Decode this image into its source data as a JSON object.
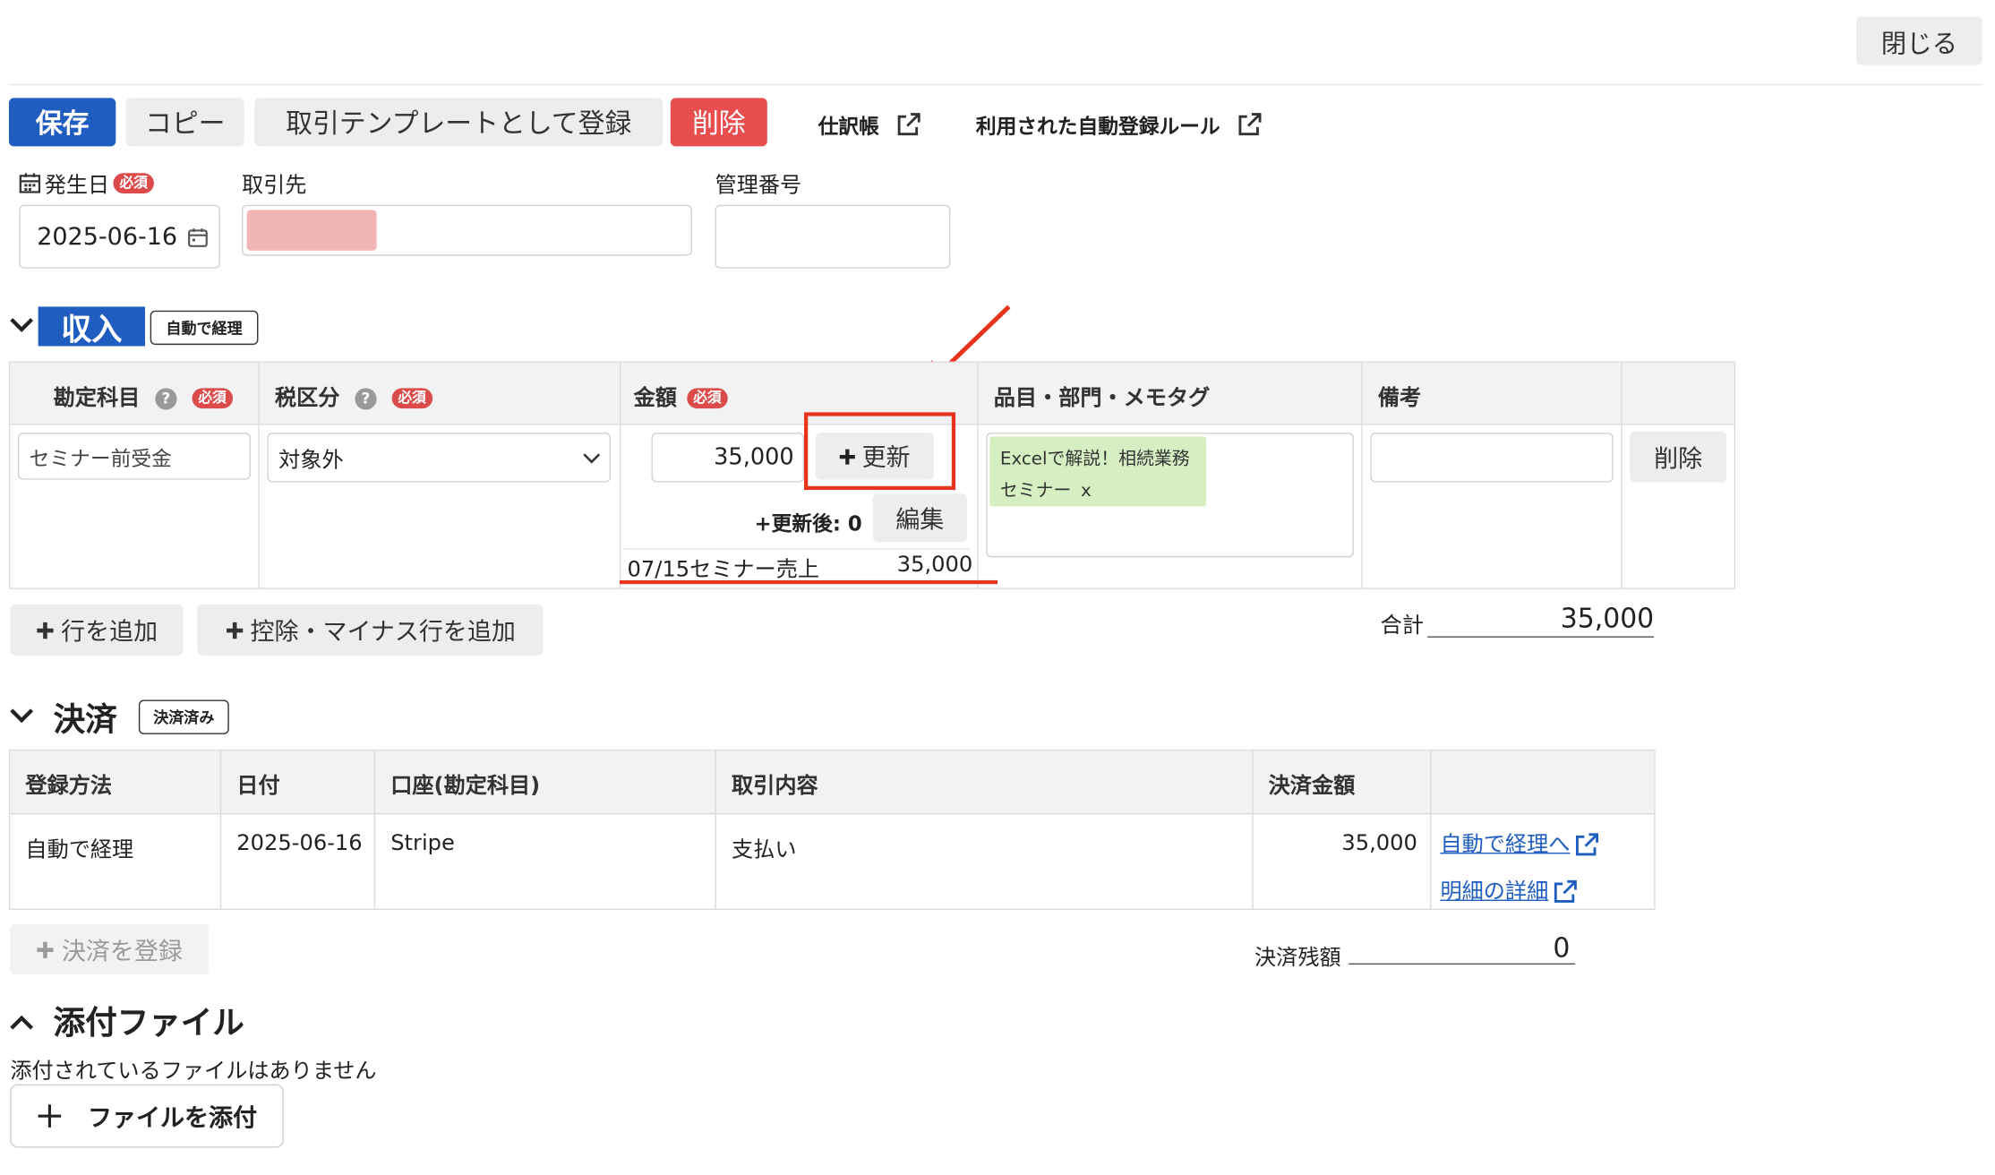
{
  "header": {
    "close_label": "閉じる"
  },
  "toolbar": {
    "save_label": "保存",
    "copy_label": "コピー",
    "template_label": "取引テンプレートとして登録",
    "delete_label": "削除",
    "journal_label": "仕訳帳",
    "autorule_label": "利用された自動登録ルール"
  },
  "form": {
    "date_label": "発生日",
    "required": "必須",
    "date_value": "2025-06-16",
    "partner_label": "取引先",
    "manage_label": "管理番号"
  },
  "income": {
    "title": "収入",
    "badge": "自動で経理",
    "headers": {
      "account": "勘定科目",
      "tax": "税区分",
      "amount": "金額",
      "item": "品目・部門・メモタグ",
      "note": "備考"
    },
    "row": {
      "account": "セミナー前受金",
      "tax": "対象外",
      "amount": "35,000",
      "update_label": "更新",
      "after_update": "+更新後: 0",
      "edit_label": "編集",
      "tag_text": "Excelで解説！相続業務セミナー",
      "tag_remove": "x",
      "delete_label": "削除"
    },
    "linked": {
      "desc": "07/15セミナー売上",
      "amount": "35,000"
    },
    "add_row_label": "行を追加",
    "add_minus_label": "控除・マイナス行を追加",
    "total_label": "合計",
    "total_value": "35,000"
  },
  "settlement": {
    "title": "決済",
    "badge": "決済済み",
    "headers": [
      "登録方法",
      "日付",
      "口座(勘定科目)",
      "取引内容",
      "決済金額"
    ],
    "row": {
      "method": "自動で経理",
      "date": "2025-06-16",
      "account": "Stripe",
      "content": "支払い",
      "amount": "35,000",
      "link1": "自動で経理へ",
      "link2": "明細の詳細"
    },
    "register_label": "決済を登録",
    "balance_label": "決済残額",
    "balance_value": "0"
  },
  "attachment": {
    "title": "添付ファイル",
    "empty_text": "添付されているファイルはありません",
    "add_label": "ファイルを添付"
  },
  "colors": {
    "primary": "#1f5dc0",
    "danger": "#e84e4e",
    "annotation": "#e8341c",
    "tag_bg": "#d6efc2"
  }
}
